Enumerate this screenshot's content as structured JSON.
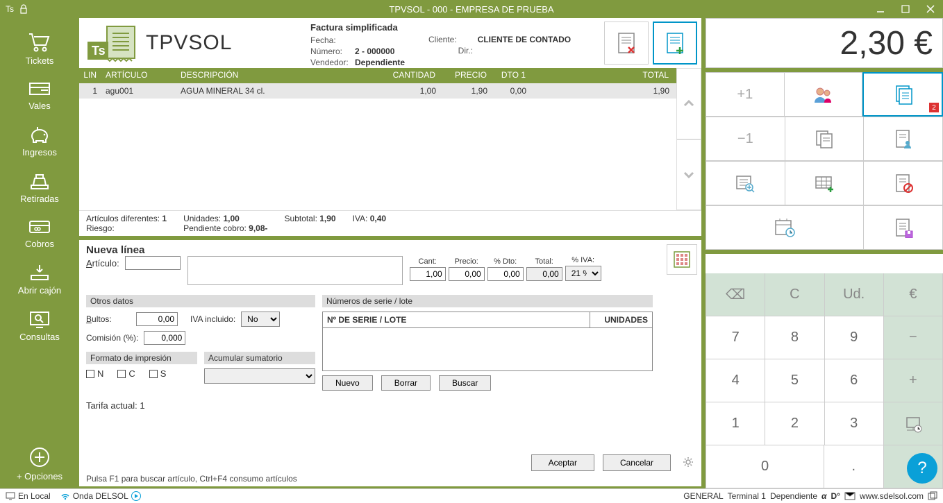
{
  "titlebar": {
    "ts": "Ts",
    "title": "TPVSOL - 000 - EMPRESA DE PRUEBA"
  },
  "sidebar": {
    "items": [
      {
        "label": "Tickets"
      },
      {
        "label": "Vales"
      },
      {
        "label": "Ingresos"
      },
      {
        "label": "Retiradas"
      },
      {
        "label": "Cobros"
      },
      {
        "label": "Abrir cajón"
      },
      {
        "label": "Consultas"
      }
    ],
    "options": "+ Opciones"
  },
  "header": {
    "brand": "TPVSOL",
    "doc_title": "Factura simplificada",
    "fecha_label": "Fecha:",
    "numero_label": "Número:",
    "numero_value": "2 - 000000",
    "vendedor_label": "Vendedor:",
    "vendedor_value": "Dependiente",
    "cliente_label": "Cliente:",
    "cliente_value": "CLIENTE DE CONTADO",
    "dir_label": "Dir.:"
  },
  "table": {
    "cols": {
      "lin": "LIN",
      "art": "ARTÍCULO",
      "desc": "DESCRIPCIÓN",
      "cant": "CANTIDAD",
      "precio": "PRECIO",
      "dto": "DTO 1",
      "total": "TOTAL"
    },
    "rows": [
      {
        "lin": "1",
        "art": "agu001",
        "desc": "AGUA MINERAL 34 cl.",
        "cant": "1,00",
        "precio": "1,90",
        "dto": "0,00",
        "total": "1,90"
      }
    ]
  },
  "summary": {
    "art_dif_label": "Artículos diferentes:",
    "art_dif_val": "1",
    "unidades_label": "Unidades:",
    "unidades_val": "1,00",
    "subtotal_label": "Subtotal:",
    "subtotal_val": "1,90",
    "iva_label": "IVA:",
    "iva_val": "0,40",
    "riesgo_label": "Riesgo:",
    "pend_label": "Pendiente cobro:",
    "pend_val": "9,08-"
  },
  "newline": {
    "title": "Nueva línea",
    "articulo_label": "Artículo:",
    "cant_label": "Cant:",
    "cant_val": "1,00",
    "precio_label": "Precio:",
    "precio_val": "0,00",
    "dto_label": "% Dto:",
    "dto_val": "0,00",
    "total_label": "Total:",
    "total_val": "0,00",
    "iva_pct_label": "% IVA:",
    "iva_pct_val": "21 %",
    "otros_title": "Otros datos",
    "bultos_label": "Bultos:",
    "bultos_val": "0,00",
    "iva_incl_label": "IVA incluido:",
    "iva_incl_val": "No",
    "comision_label": "Comisión (%):",
    "comision_val": "0,000",
    "formato_title": "Formato de impresión",
    "chk_n": "N",
    "chk_c": "C",
    "chk_s": "S",
    "acum_title": "Acumular sumatorio",
    "lote_title": "Números de serie / lote",
    "lote_col1": "Nº DE SERIE / LOTE",
    "lote_col2": "UNIDADES",
    "nuevo": "Nuevo",
    "borrar": "Borrar",
    "buscar": "Buscar",
    "tarifa": "Tarifa actual: 1",
    "aceptar": "Aceptar",
    "cancelar": "Cancelar",
    "hint": "Pulsa F1 para buscar artículo, Ctrl+F4 consumo artículos"
  },
  "right": {
    "total": "2,30 €",
    "plus1": "+1",
    "minus1": "−1",
    "badge": "2",
    "keypad": {
      "bs": "⌫",
      "c": "C",
      "ud": "Ud.",
      "eur": "€",
      "k7": "7",
      "k8": "8",
      "k9": "9",
      "minus": "−",
      "k4": "4",
      "k5": "5",
      "k6": "6",
      "plus": "+",
      "k1": "1",
      "k2": "2",
      "k3": "3",
      "k0": "0",
      "dot": ".",
      "back": "↩"
    }
  },
  "status": {
    "local": "En Local",
    "onda": "Onda DELSOL",
    "general": "GENERAL",
    "terminal": "Terminal 1",
    "dep": "Dependiente",
    "url": "www.sdelsol.com"
  }
}
